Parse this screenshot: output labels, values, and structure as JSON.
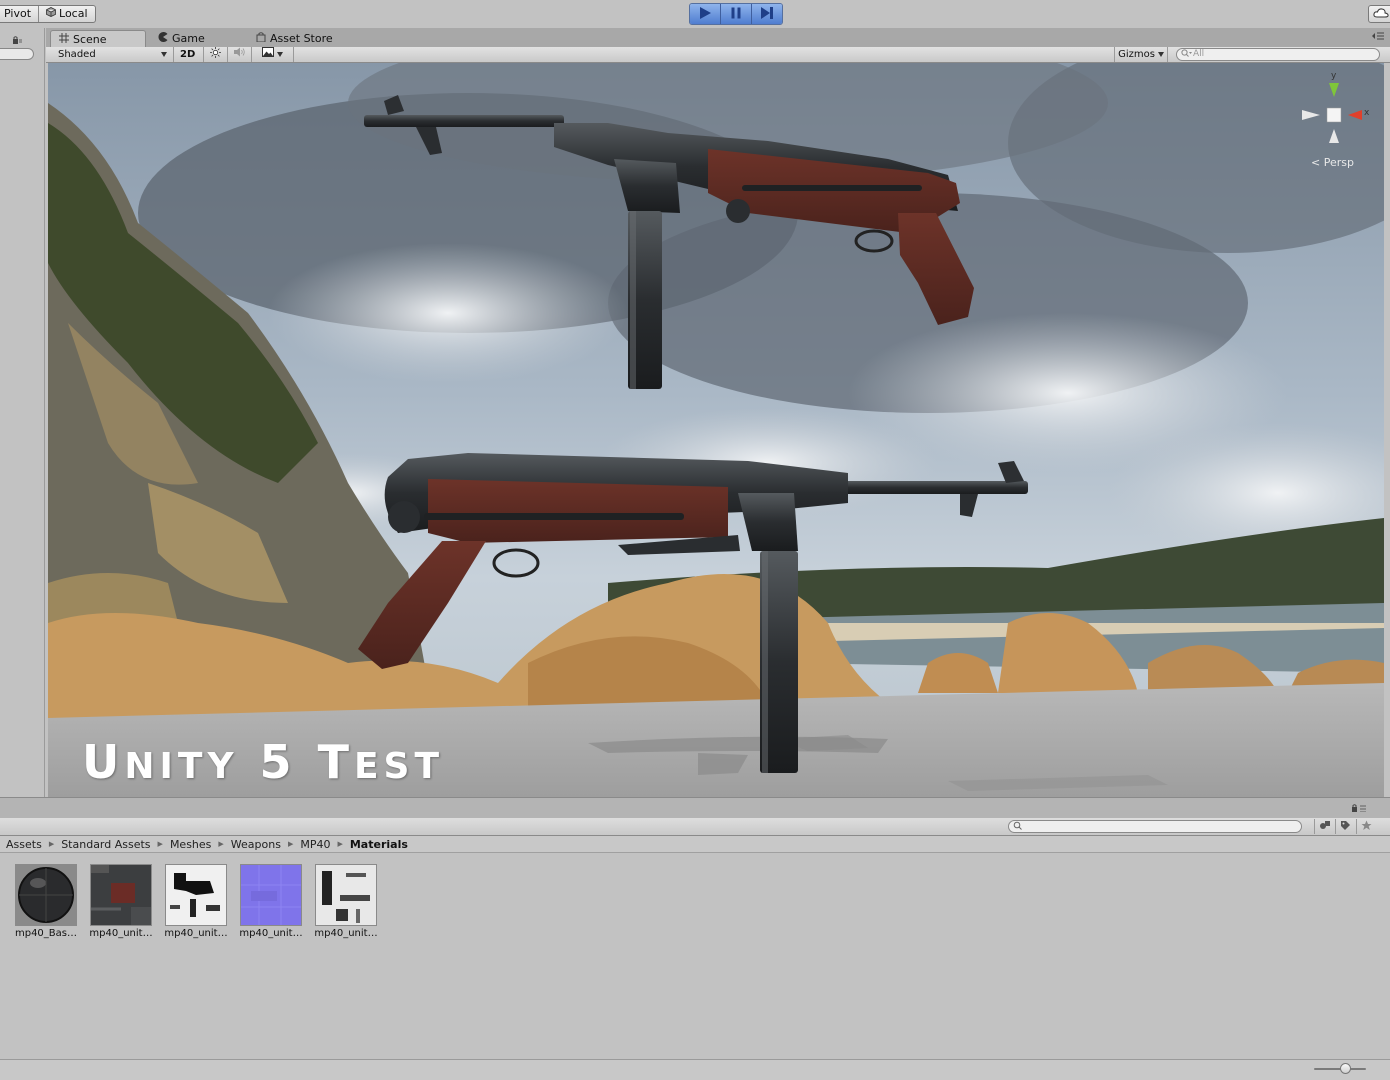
{
  "toolbar": {
    "pivot_label": "Pivot",
    "local_label": "Local"
  },
  "tabs": {
    "scene": "Scene",
    "game": "Game",
    "asset_store": "Asset Store"
  },
  "scene_controls": {
    "shading_mode": "Shaded",
    "mode_2d": "2D",
    "gizmos": "Gizmos",
    "search_placeholder": "All"
  },
  "viewport": {
    "title_parts": [
      "U",
      "NITY",
      " 5 ",
      "T",
      "EST"
    ],
    "title": "Unity 5 Test",
    "projection_label": "Persp",
    "axis_labels": {
      "y": "y",
      "x": "x"
    },
    "axis_colors": {
      "y": "#7fc63a",
      "x": "#e0402c",
      "z": "#e8e8e8"
    }
  },
  "breadcrumb": {
    "items": [
      "Assets",
      "Standard Assets",
      "Meshes",
      "Weapons",
      "MP40",
      "Materials"
    ]
  },
  "assets": {
    "items": [
      {
        "label": "mp40_Bas…",
        "kind": "material-sphere"
      },
      {
        "label": "mp40_unit…",
        "kind": "albedo-texture"
      },
      {
        "label": "mp40_unit…",
        "kind": "mask-texture"
      },
      {
        "label": "mp40_unit…",
        "kind": "normal-texture"
      },
      {
        "label": "mp40_unit…",
        "kind": "occlusion-texture"
      }
    ]
  },
  "colors": {
    "play_accent": "#4f7dd0",
    "panel_gray": "#c2c2c2",
    "wood_stock": "#5e2b24"
  }
}
